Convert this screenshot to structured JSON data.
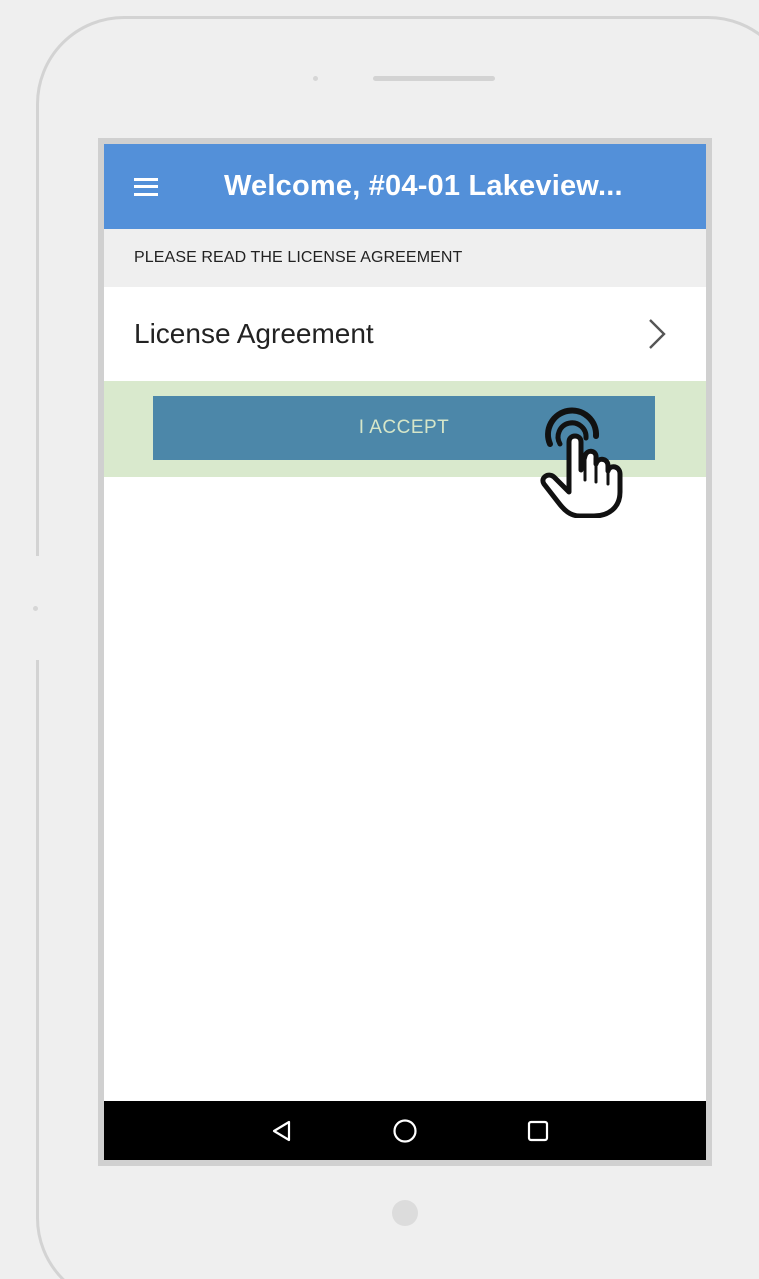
{
  "app_bar": {
    "title": "Welcome, #04-01 Lakeview...",
    "menu_icon": "hamburger-menu-icon",
    "color": "#5390d9"
  },
  "section_header": {
    "text": "PLEASE READ THE LICENSE AGREEMENT"
  },
  "license_row": {
    "label": "License Agreement",
    "trailing_icon": "chevron-right-icon"
  },
  "accept_button": {
    "label": "I ACCEPT",
    "color": "#4c87a9",
    "band_color": "#d9e9cd"
  },
  "nav_bar": {
    "items": [
      {
        "icon": "back-triangle-icon"
      },
      {
        "icon": "home-circle-icon"
      },
      {
        "icon": "recents-square-icon"
      }
    ]
  },
  "overlay": {
    "icon": "hand-cursor-icon"
  }
}
